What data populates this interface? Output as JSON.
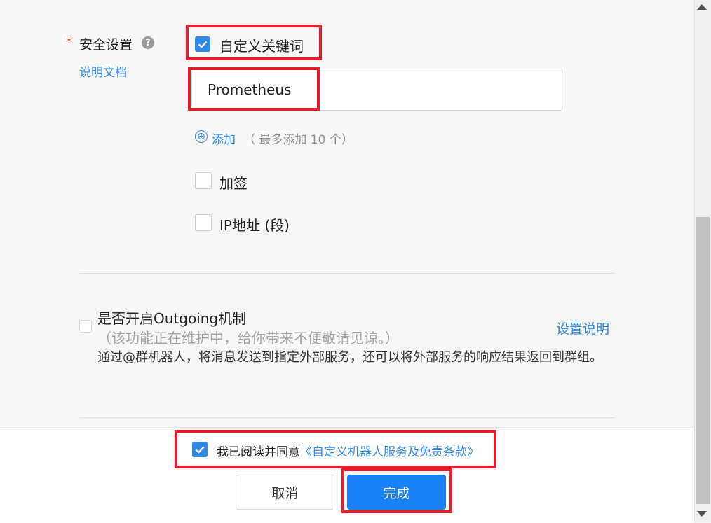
{
  "security": {
    "required_mark": "*",
    "label": "安全设置",
    "help_icon": "?",
    "doc_link": "说明文档",
    "keyword_option": {
      "label": "自定义关键词",
      "checked": true
    },
    "keyword_value": "Prometheus",
    "add": {
      "icon": "⊕",
      "label": "添加",
      "hint": "（ 最多添加 10 个）"
    },
    "sign_option": {
      "label": "加签",
      "checked": false
    },
    "ip_option": {
      "label": "IP地址 (段)",
      "checked": false
    }
  },
  "outgoing": {
    "title": "是否开启Outgoing机制",
    "note": "（该功能正在维护中，给你带来不便敬请见谅。）",
    "description": "通过@群机器人，将消息发送到指定外部服务，还可以将外部服务的响应结果返回到群组。",
    "help_link": "设置说明",
    "checked": false
  },
  "footer": {
    "agree_text": "我已阅读并同意",
    "agree_link": "《自定义机器人服务及免责条款》",
    "agree_checked": true,
    "cancel_label": "取消",
    "done_label": "完成"
  },
  "colors": {
    "accent": "#2f8ae5",
    "primary_button": "#1a82f7",
    "highlight": "#e81d2b"
  }
}
